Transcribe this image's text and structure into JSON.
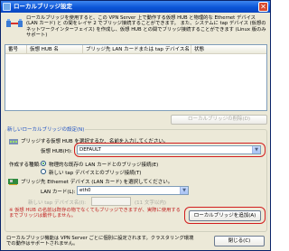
{
  "window": {
    "title": "ローカルブリッジ設定",
    "close_glyph": "✕"
  },
  "header": {
    "description": "ローカルブリッジを使用すると、この VPN Server 上で動作する仮想 HUB と物理的な Ethernet デバイス (LAN カード) と の間をレイヤ 2 でブリッジ接続することができます。 また、システムに tap デバイス (仮想のネットワークインターフェイス) を作成し、仮想 HUB との間でブリッジ接続することができます (Linux 版のみサポート)"
  },
  "bridge_list": {
    "columns": [
      "番号",
      "仮想 HUB 名",
      "ブリッジ先 LAN カードまたは tap デバイス名",
      "状態"
    ],
    "rows": []
  },
  "delete_button": {
    "label": "ローカルブリッジの削除(D)"
  },
  "new_bridge": {
    "group_title": "新しいローカルブリッジの設定(N)",
    "hub_instruction": "ブリッジする仮想 HUB を選択するか、名前を入力してください。",
    "hub_label": "仮想 HUB(H):",
    "hub_value": "DEFAULT",
    "type_label": "作成する種類:",
    "radio_physical": "物理的な既存の LAN カードとのブリッジ接続(E)",
    "radio_tap": "新しい tap デバイスとのブリッジ接続(T)",
    "physical_radio_checked": true,
    "lan_instruction": "ブリッジ先 Ethernet デバイス (LAN カード) を選択してください。",
    "lan_label": "LAN カード(L):",
    "lan_value": "eth0",
    "tap_label": "新しい tap デバイス名(I):",
    "tap_hint": "(11 文字以内)",
    "note": "※ 仮想 HUB の名前は既存の物でなくてもブリッジできますが、実際に使用するまでブリッジは動作しません。",
    "add_button": "ローカルブリッジを追加(A)"
  },
  "footer": {
    "note": "ローカルブリッジ機能は VPN Server ごとに個別に設定されます。クラスタリング環境での動作はサポートされません。",
    "close_button": "閉じる(C)"
  },
  "colors": {
    "highlight_ring": "#d21e1e",
    "title_bar": "#0b55d8",
    "group_title": "#1b4fc4"
  }
}
